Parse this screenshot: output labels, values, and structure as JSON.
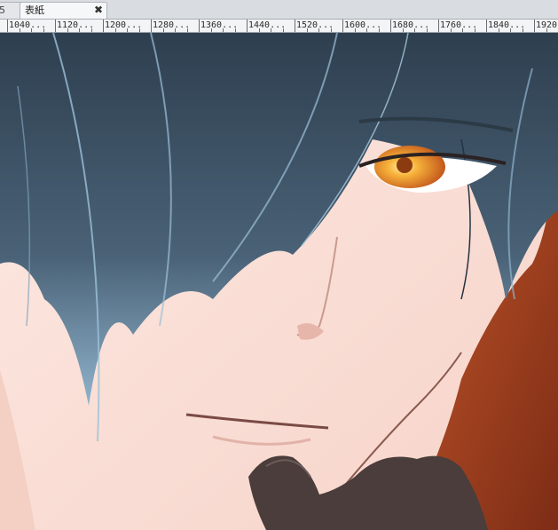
{
  "tabs": [
    {
      "label": "5",
      "modified": true
    },
    {
      "label": "表紙",
      "close_glyph": "✖"
    }
  ],
  "ruler": {
    "labels": [
      "1040...",
      "1120...",
      "1200...",
      "1280...",
      "1360...",
      "1440...",
      "1520...",
      "1600...",
      "1680...",
      "1760...",
      "1840...",
      "1920"
    ]
  },
  "canvas": {
    "subject": "illustration",
    "colors": {
      "skin": "#fbe9e3",
      "hair": "#3f5466",
      "hair_highlight": "#8fb3cc",
      "eye": "#f2a22c",
      "glove": "#4a3d3b",
      "background": "#a8431f"
    }
  }
}
